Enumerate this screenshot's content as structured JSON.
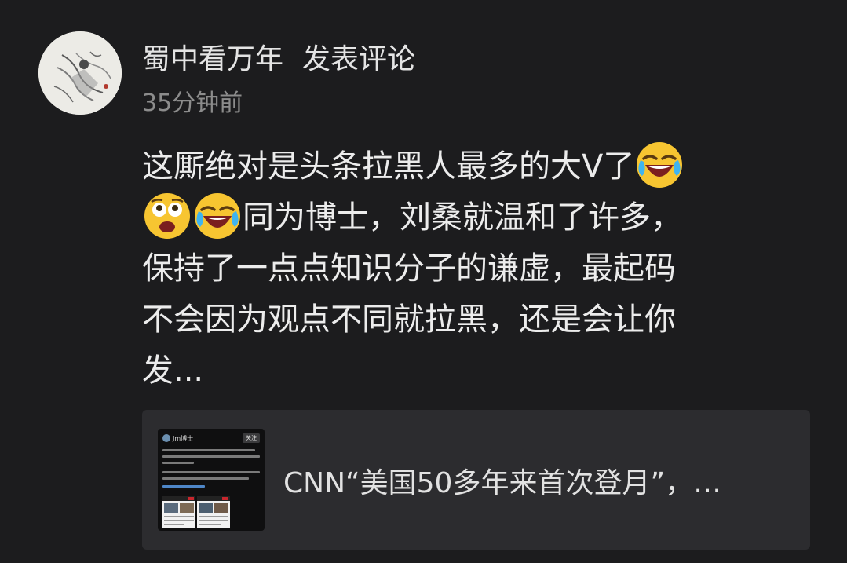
{
  "comment_header": {
    "author": "蜀中看万年",
    "action": "发表评论",
    "time": "35分钟前"
  },
  "comment": {
    "line1": "这厮绝对是头条拉黑人最多的大V了",
    "line2": "同为博士，刘桑就温和了许多，",
    "line3": "保持了一点点知识分子的谦虚，最起码",
    "line4": "不会因为观点不同就拉黑，还是会让你",
    "line5": "发...",
    "emojis": [
      "laughing-crying-emoji",
      "surprised-emoji",
      "laughing-crying-emoji"
    ]
  },
  "linked_post": {
    "title": "CNN“美国50多年来首次登月”，…",
    "thumbnail": {
      "name": "Jm博士",
      "follow": "关注"
    }
  },
  "colors": {
    "background": "#1c1c1e",
    "card": "#2c2c2f",
    "text": "#ececec",
    "muted": "#8c8c8c",
    "emoji_face": "#f7c531"
  }
}
